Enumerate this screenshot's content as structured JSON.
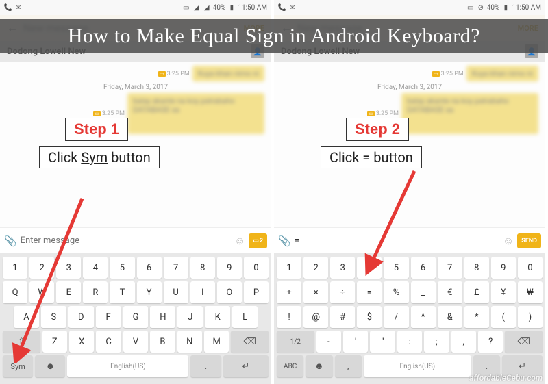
{
  "overlay_title": "How to Make Equal Sign in Android Keyboard?",
  "watermark": "affordableCebu.com",
  "status": {
    "battery": "40%",
    "time": "11:50 AM"
  },
  "header": {
    "title": "New message",
    "more": "MORE"
  },
  "contact": {
    "name": "Dodong Lowell New"
  },
  "chat": {
    "msg1_time": "3:25 PM",
    "msg1_text": "Kuya khan nimo ni",
    "date": "Friday, March 3, 2017",
    "msg2_time": "3:25 PM",
    "msg2_text": "balay akante na koy patrabaho DATABASE sa"
  },
  "step1": {
    "label": "Step 1",
    "instruction": "Click Sym button",
    "input_placeholder": "Enter message",
    "send": "2"
  },
  "step2": {
    "label": "Step 2",
    "instruction": "Click = button",
    "input_value": "=",
    "send": "SEND"
  },
  "kb": {
    "numbers": [
      "1",
      "2",
      "3",
      "4",
      "5",
      "6",
      "7",
      "8",
      "9",
      "0"
    ],
    "qwerty_r1": [
      "Q",
      "W",
      "E",
      "R",
      "T",
      "Y",
      "U",
      "I",
      "O",
      "P"
    ],
    "qwerty_r2": [
      "A",
      "S",
      "D",
      "F",
      "G",
      "H",
      "J",
      "K",
      "L"
    ],
    "qwerty_r3": [
      "Z",
      "X",
      "C",
      "V",
      "B",
      "N",
      "M"
    ],
    "qwerty_shift": "⇧",
    "qwerty_bksp": "⌫",
    "sym_key": "Sym",
    "lang": "English(US)",
    "enter": "↵",
    "emoji": "☻",
    "comma": ",",
    "period": ".",
    "sym_r1": [
      "+",
      "×",
      "÷",
      "=",
      "%",
      "_",
      "€",
      "£",
      "¥",
      "₩"
    ],
    "sym_r2": [
      "!",
      "@",
      "#",
      "$",
      "/",
      "^",
      "&",
      "*",
      "(",
      ")"
    ],
    "sym_r3": [
      "-",
      "'",
      "\"",
      ":",
      ";",
      ",",
      "?"
    ],
    "sym_page": "1/2",
    "abc_key": "ABC"
  }
}
